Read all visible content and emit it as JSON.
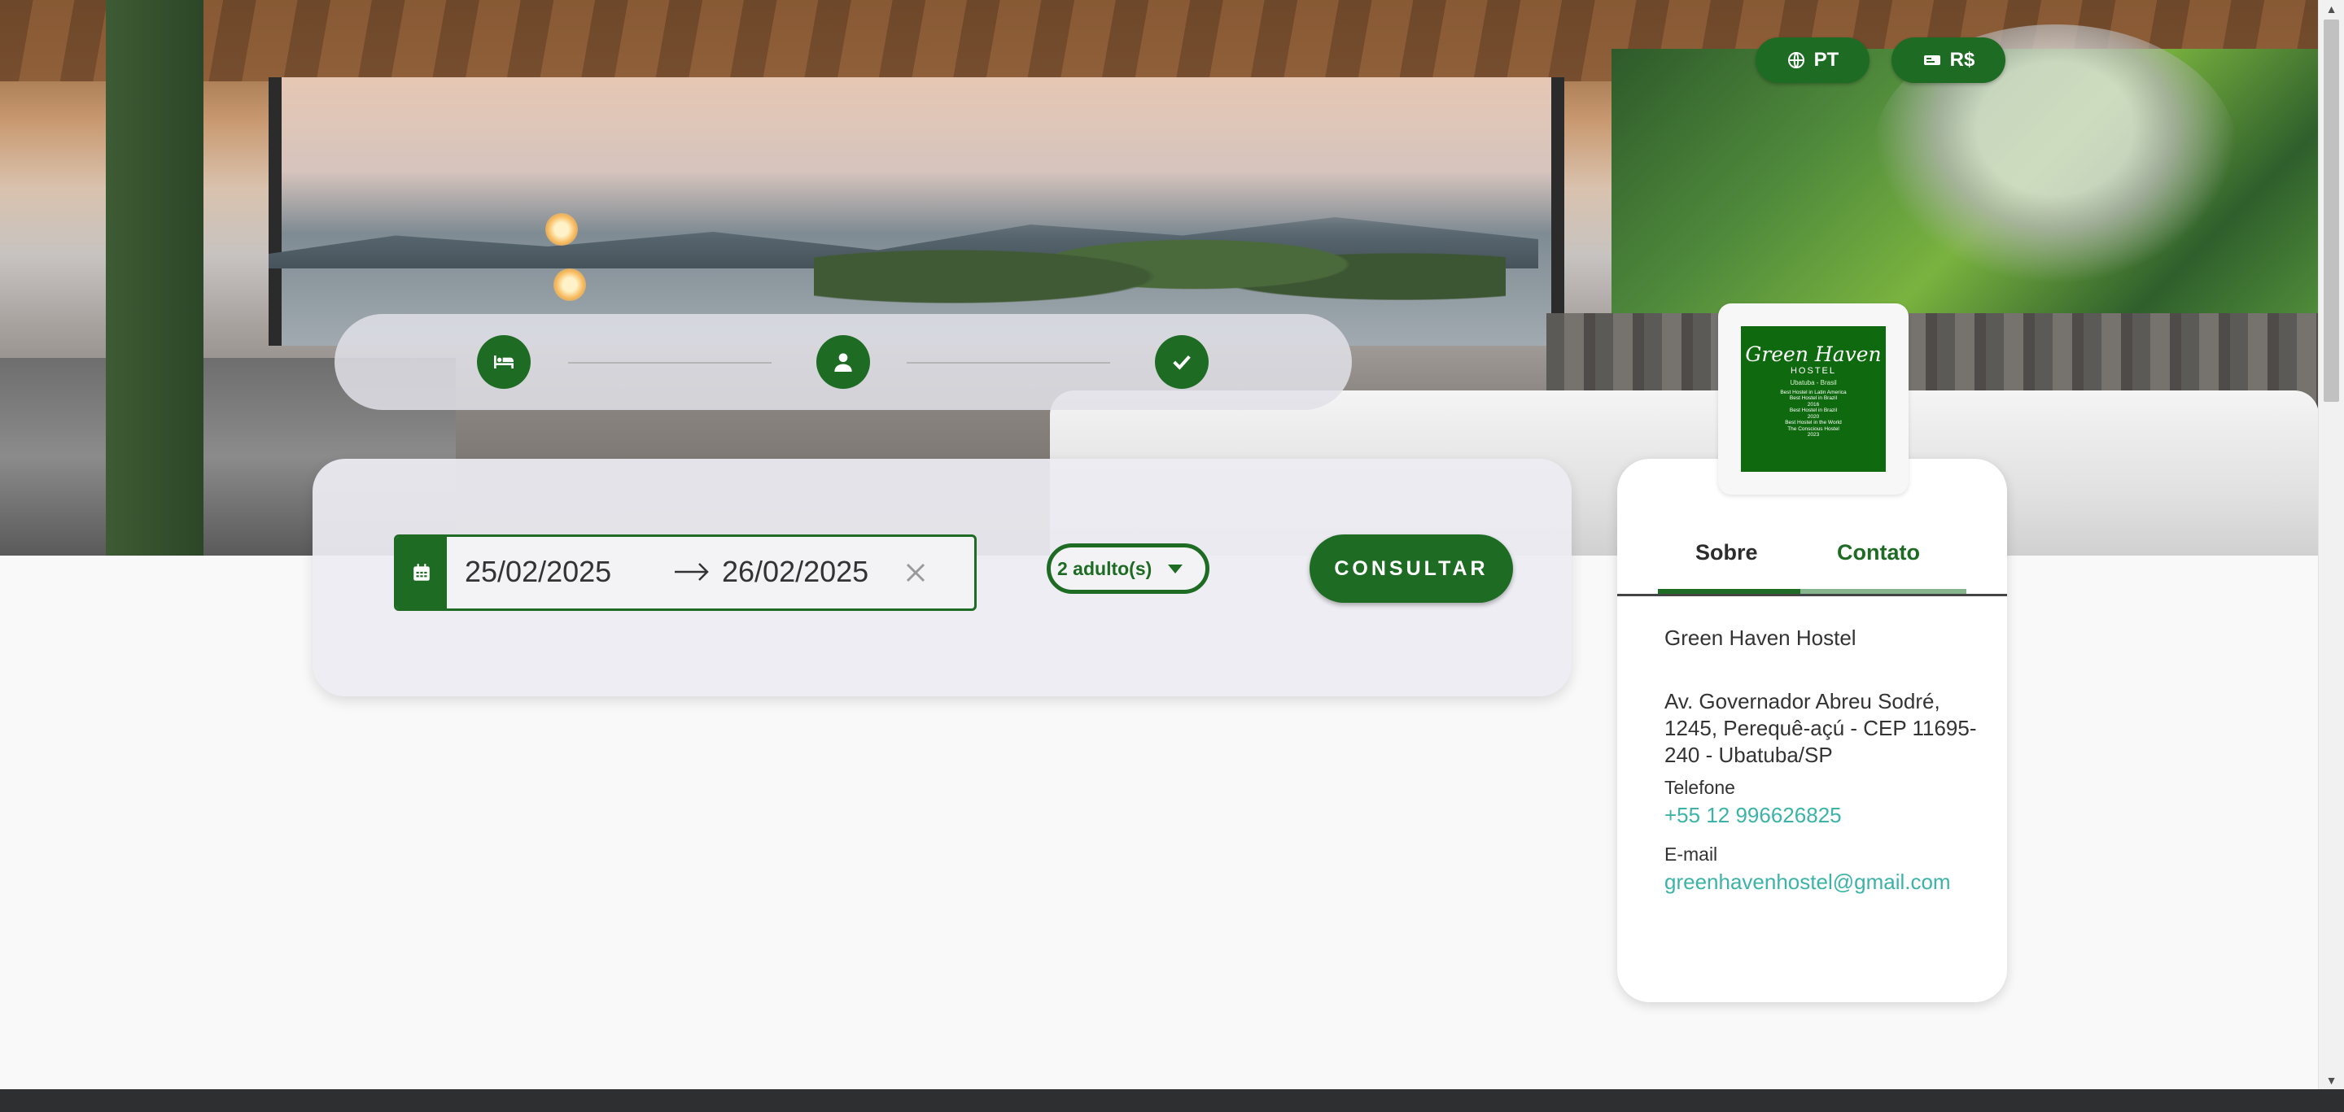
{
  "header": {
    "language_label": "PT",
    "currency_label": "R$",
    "language_icon": "globe-icon",
    "currency_icon": "money-bill-icon"
  },
  "steps": {
    "items": [
      {
        "name": "room",
        "icon": "bed-icon"
      },
      {
        "name": "guest",
        "icon": "user-icon"
      },
      {
        "name": "confirm",
        "icon": "check-icon"
      }
    ]
  },
  "search": {
    "checkin": "25/02/2025",
    "checkout": "26/02/2025",
    "guests_label": "2 adulto(s)",
    "submit_label": "CONSULTAR",
    "calendar_icon": "calendar-icon",
    "arrow_icon": "arrow-right-icon",
    "clear_icon": "close-icon",
    "dropdown_icon": "caret-down-icon"
  },
  "logo": {
    "brand": "Green Haven",
    "sub": "HOSTEL",
    "place": "Ubatuba - Brasil",
    "awards": [
      "Best Hostel in Latin America",
      "Best Hostel in Brazil",
      "2016",
      "Best Hostel in Brazil",
      "2020",
      "Best Hostel in the World",
      "The Conscious Hostel",
      "2023"
    ]
  },
  "info": {
    "tab_about": "Sobre",
    "tab_contact": "Contato",
    "name": "Green Haven Hostel",
    "address": "Av. Governador Abreu Sodré, 1245, Perequê-açú - CEP 11695-240 - Ubatuba/SP",
    "phone_label": "Telefone",
    "phone": "+55 12 996626825",
    "email_label": "E-mail",
    "email": "greenhavenhostel@gmail.com"
  },
  "colors": {
    "brand_green": "#1e6b24",
    "link_teal": "#3bb3a7",
    "tab_inactive": "#86b48c"
  }
}
